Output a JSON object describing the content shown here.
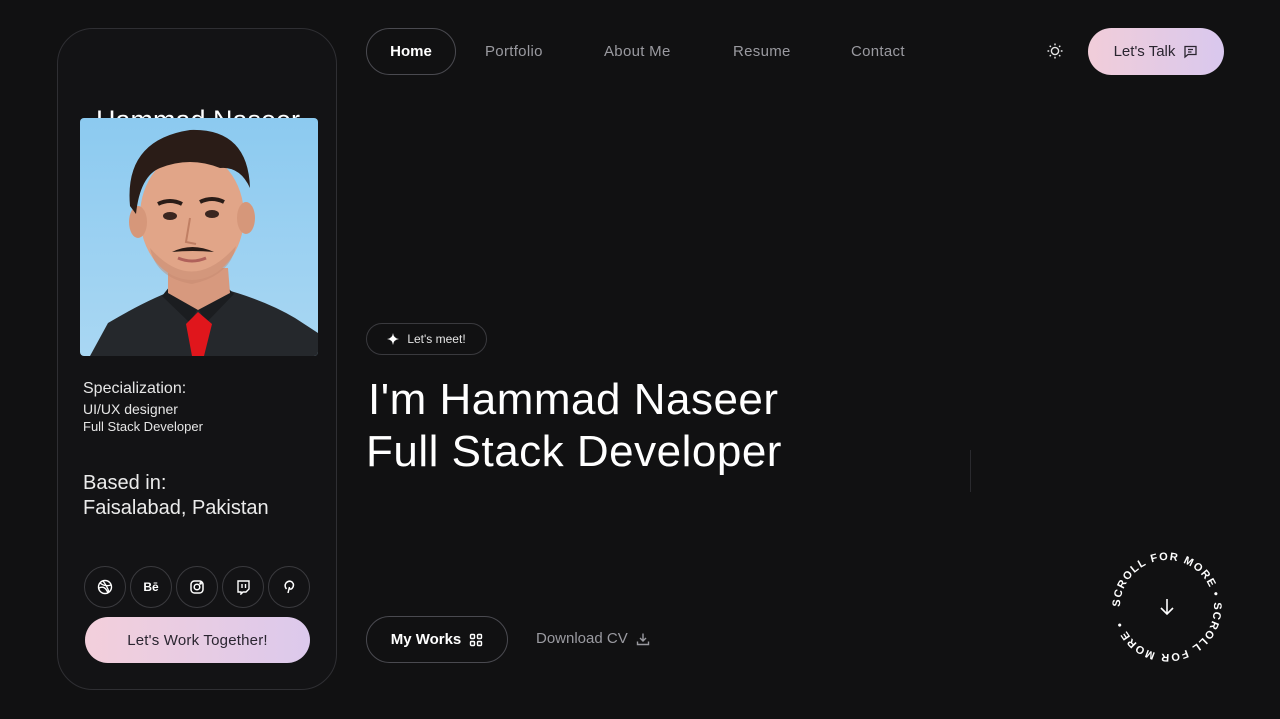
{
  "card": {
    "name": "Hammad Naseer",
    "specialization_label": "Specialization:",
    "specializations": [
      "UI/UX designer",
      "Full Stack Developer"
    ],
    "based_label": "Based in:",
    "based_value": "Faisalabad, Pakistan",
    "socials": [
      {
        "icon": "dribbble-icon"
      },
      {
        "icon": "behance-icon",
        "glyph": "Bē"
      },
      {
        "icon": "instagram-icon"
      },
      {
        "icon": "twitch-icon"
      },
      {
        "icon": "pinterest-icon"
      }
    ],
    "cta_label": "Let's Work Together!"
  },
  "nav": {
    "items": [
      "Home",
      "Portfolio",
      "About Me",
      "Resume",
      "Contact"
    ],
    "active": "Home",
    "cta_label": "Let's Talk"
  },
  "hero": {
    "badge": "Let's meet!",
    "line1": "I'm Hammad Naseer",
    "line2": "Full Stack Developer",
    "primary_btn": "My Works",
    "secondary_btn": "Download CV"
  },
  "scroll": {
    "text": "SCROLL FOR MORE • SCROLL FOR MORE • "
  },
  "colors": {
    "background": "#111112",
    "accent_pink": "#f3cfdb",
    "accent_lavender": "#dcc9ec",
    "muted_text": "#9a9aa0"
  }
}
